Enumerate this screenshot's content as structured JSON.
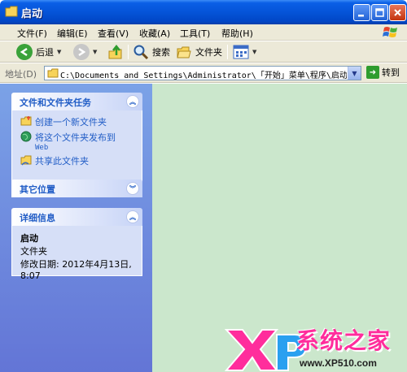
{
  "window": {
    "title": "启动"
  },
  "menu": [
    "文件(F)",
    "编辑(E)",
    "查看(V)",
    "收藏(A)",
    "工具(T)",
    "帮助(H)"
  ],
  "toolbar": {
    "back": "后退",
    "search": "搜索",
    "folders": "文件夹"
  },
  "address": {
    "label": "地址(D)",
    "value": "C:\\Documents and Settings\\Administrator\\「开始」菜单\\程序\\启动",
    "go": "转到"
  },
  "tasks_panel": {
    "title": "文件和文件夹任务",
    "items": [
      {
        "label": "创建一个新文件夹",
        "icon": "new-folder-icon"
      },
      {
        "label": "将这个文件夹发布到",
        "sub": "Web",
        "icon": "globe-icon"
      },
      {
        "label": "共享此文件夹",
        "icon": "share-folder-icon"
      }
    ]
  },
  "other_panel": {
    "title": "其它位置"
  },
  "details_panel": {
    "title": "详细信息",
    "name": "启动",
    "type": "文件夹",
    "modified_label": "修改日期: 2012年4月13日,",
    "modified_time": "8:07"
  },
  "watermark": {
    "brand": "系统之家",
    "url": "www.XP510.com"
  },
  "colors": {
    "titlebar": "#0554d8",
    "leftpane": "#7ba2e7",
    "content": "#cbe7cc",
    "link": "#215dc6"
  }
}
